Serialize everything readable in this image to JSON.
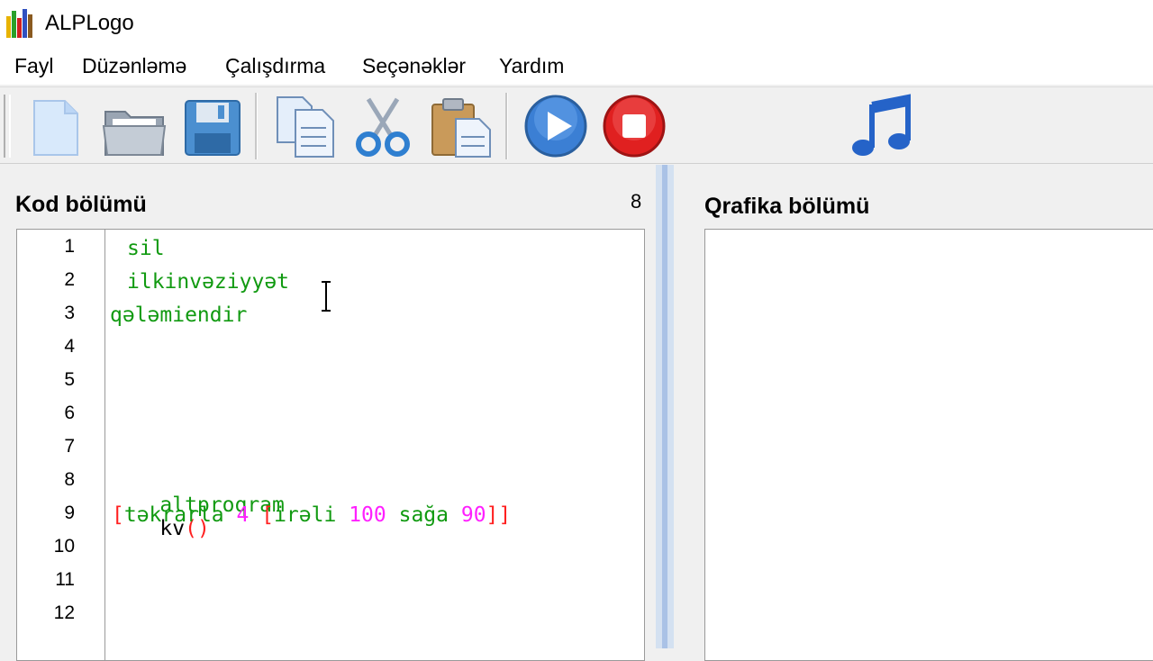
{
  "window": {
    "title": "ALPLogo",
    "icon": "alplogo-app-icon"
  },
  "menu": [
    "Fayl",
    "Düzənləmə",
    "Çalışdırma",
    "Seçənəklər",
    "Yardım"
  ],
  "toolbar": {
    "buttons": [
      "new-file-icon",
      "open-folder-icon",
      "save-icon",
      "copy-icon",
      "cut-icon",
      "paste-icon",
      "run-icon",
      "stop-icon",
      "music-icon"
    ]
  },
  "code_panel": {
    "title": "Kod bölümü",
    "line_count": "8",
    "line_numbers": [
      "1",
      "2",
      "3",
      "4",
      "5",
      "6",
      "7",
      "8",
      "9",
      "10",
      "11",
      "12"
    ],
    "lines": {
      "l1": "sil",
      "l2": "ilkinvəziyyət",
      "l3": "qələmiendir",
      "l8_kw": "altproqram",
      "l8_name": "kv",
      "l8_parens": "()",
      "l9_open": "[",
      "l9_repeat": "təkrarla",
      "l9_count": "4",
      "l9_open2": "[",
      "l9_forward": "irəli",
      "l9_fwd_val": "100",
      "l9_right": "sağa",
      "l9_right_val": "90",
      "l9_close": "]]"
    }
  },
  "graphics_panel": {
    "title": "Qrafika bölümü"
  },
  "colors": {
    "keyword_green": "#119a11",
    "bracket_red": "#ff2020",
    "number_magenta": "#ff20ff",
    "splitter_blue": "#aac2e6"
  }
}
